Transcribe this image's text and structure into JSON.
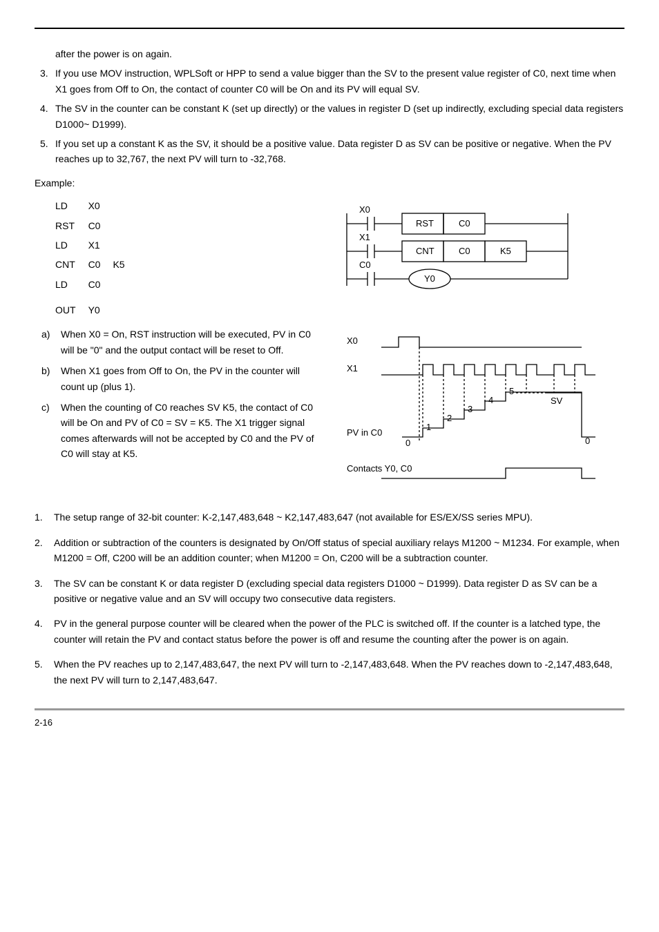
{
  "intro_continuation": "after the power is on again.",
  "top_list": {
    "item3": "If you use MOV instruction, WPLSoft or HPP to send a value bigger than the SV to the present value register of C0, next time when X1 goes from Off to On, the contact of counter C0 will be On and its PV will equal SV.",
    "item4": "The SV in the counter can be constant K (set up directly) or the values in register D (set up indirectly, excluding special data registers D1000~ D1999).",
    "item5": "If you set up a constant K as the SV, it should be a positive value. Data register D as SV can be positive or negative. When the PV reaches up to 32,767, the next PV will turn to -32,768."
  },
  "example_label": "Example:",
  "instructions": {
    "r1": {
      "op": "LD",
      "a1": "X0",
      "a2": ""
    },
    "r2": {
      "op": "RST",
      "a1": "C0",
      "a2": ""
    },
    "r3": {
      "op": "LD",
      "a1": "X1",
      "a2": ""
    },
    "r4": {
      "op": "CNT",
      "a1": "C0",
      "a2": "K5"
    },
    "r5": {
      "op": "LD",
      "a1": "C0",
      "a2": ""
    },
    "r6": {
      "op": "OUT",
      "a1": "Y0",
      "a2": ""
    }
  },
  "ladder": {
    "x0": "X0",
    "x1": "X1",
    "c0": "C0",
    "rst": "RST",
    "cnt": "CNT",
    "k5": "K5",
    "y0": "Y0"
  },
  "lettered_list": {
    "a": "When X0 = On, RST instruction will be executed, PV in C0 will be \"0\" and the output contact will be reset to Off.",
    "b": "When X1 goes from Off to On, the PV in the counter will count up (plus 1).",
    "c": "When the counting of C0 reaches SV K5, the contact of C0 will be On and PV of C0 = SV = K5. The X1 trigger signal comes afterwards will not be accepted by C0 and the PV of C0 will stay at K5."
  },
  "timing": {
    "x0": "X0",
    "x1": "X1",
    "pv": "PV in C0",
    "contacts": "Contacts Y0, C0",
    "n0": "0",
    "n1": "1",
    "n2": "2",
    "n3": "3",
    "n4": "4",
    "n5": "5",
    "sv": "SV",
    "n0r": "0"
  },
  "bottom_list": {
    "item1": "The setup range of 32-bit counter: K-2,147,483,648 ~ K2,147,483,647 (not available for ES/EX/SS series MPU).",
    "item2": "Addition or subtraction of the counters is designated by On/Off status of special auxiliary relays M1200 ~ M1234. For example, when M1200 = Off, C200 will be an addition counter; when M1200 = On, C200 will be a subtraction counter.",
    "item3": "The SV can be constant K or data register D (excluding special data registers D1000 ~ D1999). Data register D as SV can be a positive or negative value and an SV will occupy two consecutive data registers.",
    "item4": "PV in the general purpose counter will be cleared when the power of the PLC is switched off. If the counter is a latched type, the counter will retain the PV and contact status before the power is off and resume the counting after the power is on again.",
    "item5": "When the PV reaches up to 2,147,483,647, the next PV will turn to -2,147,483,648. When the PV reaches down to -2,147,483,648, the next PV will turn to 2,147,483,647."
  },
  "page_number": "2-16"
}
